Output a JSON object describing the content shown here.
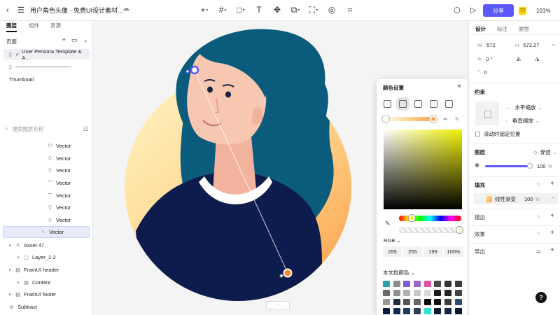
{
  "topbar": {
    "title": "用户角色头像 - 免费UI设计素材...",
    "share_label": "分享",
    "badge_label": "T7",
    "zoom": "101%"
  },
  "left": {
    "tabs": [
      "图层",
      "组件",
      "资源"
    ],
    "pages_label": "页面",
    "pages": [
      {
        "label": "User Persona Template & A..."
      },
      {
        "label": "--------------------------------"
      },
      {
        "label": "Thumbnail"
      }
    ],
    "search_placeholder": "搜索图层名称",
    "layers": [
      {
        "label": "Vector",
        "icon": "ellipse"
      },
      {
        "label": "Vector",
        "icon": "vector"
      },
      {
        "label": "Vector",
        "icon": "vector"
      },
      {
        "label": "Vector",
        "icon": "pen"
      },
      {
        "label": "Vector",
        "icon": "pen"
      },
      {
        "label": "Vector",
        "icon": "vector"
      },
      {
        "label": "Vector",
        "icon": "vector"
      },
      {
        "label": "Vector",
        "icon": "ellipse"
      },
      {
        "label": "Asset 47",
        "icon": "group"
      },
      {
        "label": "Layer_1-2",
        "icon": "frame"
      },
      {
        "label": "FramUI header",
        "icon": "frame"
      },
      {
        "label": "Content",
        "icon": "frame"
      },
      {
        "label": "FramUI footer",
        "icon": "frame"
      },
      {
        "label": "Subtract",
        "icon": "subtract"
      }
    ]
  },
  "colorpanel": {
    "title": "颜色设置",
    "mode": "RGB",
    "values": [
      "255",
      "255",
      "199",
      "100%"
    ],
    "doc_colors_label": "本文档颜色",
    "swatches": [
      "#2aa4a6",
      "#8a8a8a",
      "#7b5cd6",
      "#9a66c9",
      "#e24fa1",
      "#4a4a4a",
      "#333333",
      "#3a3a3a",
      "#6a6a6a",
      "#909090",
      "#b0b0b0",
      "#c8c8c8",
      "#d8d8d8",
      "#1a1a1a",
      "#222222",
      "#444444",
      "#999999",
      "#1f2b3a",
      "#555555",
      "#666666",
      "#0a0a0a",
      "#111111",
      "#3a3a3a",
      "#2c4a6e",
      "#0c1b3d",
      "#122a52",
      "#1c3a63",
      "#2e3f5c",
      "#36e0d8",
      "#0f1a33",
      "#13264a",
      "#0d1a2e"
    ]
  },
  "right": {
    "tabs": [
      "设计",
      "标注",
      "原型"
    ],
    "w_label": "W",
    "w_value": "572",
    "h_label": "H",
    "h_value": "572.27",
    "rotation": "0 °",
    "radius": "0",
    "constraint_title": "约束",
    "h_constraint": "水平缩放",
    "v_constraint": "垂直缩放",
    "fixed_scroll": "滚动时固定位置",
    "layer_title": "图层",
    "blend": "穿透",
    "opacity": "100",
    "opacity_unit": "%",
    "fill_title": "填充",
    "fill_type": "线性渐变",
    "fill_opacity": "100",
    "fill_unit": "%",
    "stroke_title": "描边",
    "effect_title": "效果",
    "export_title": "导出"
  }
}
